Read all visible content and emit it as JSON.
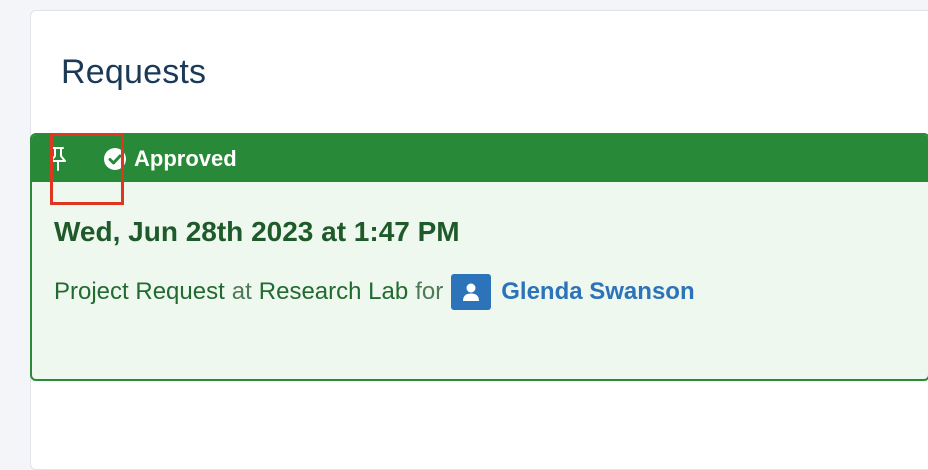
{
  "panel": {
    "title": "Requests"
  },
  "card": {
    "status_label": "Approved",
    "date": "Wed, Jun 28th 2023 at 1:47 PM",
    "request_type": "Project Request",
    "at_word": "at",
    "location": "Research Lab",
    "for_word": "for",
    "user_name": "Glenda Swanson"
  },
  "icons": {
    "pin": "pin-icon",
    "status": "check-circle-icon",
    "user": "user-icon"
  },
  "colors": {
    "header_green": "#288a38",
    "card_bg": "#eef8ef",
    "link_blue": "#2c73b9",
    "highlight_red": "#e0361f"
  }
}
